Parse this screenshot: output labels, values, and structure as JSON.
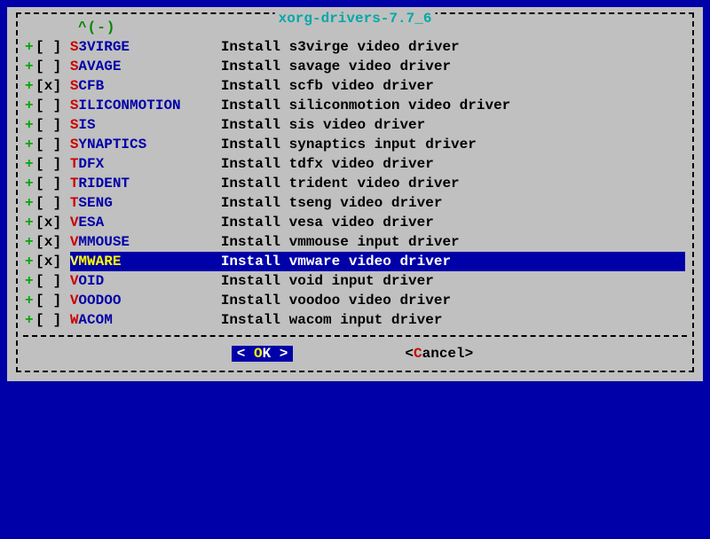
{
  "title": "xorg-drivers-7.7_6",
  "scroll_hint": "^(-)",
  "items": [
    {
      "checked": false,
      "hot": "S",
      "rest": "3VIRGE",
      "desc": "Install s3virge video driver",
      "selected": false
    },
    {
      "checked": false,
      "hot": "S",
      "rest": "AVAGE",
      "desc": "Install savage video driver",
      "selected": false
    },
    {
      "checked": true,
      "hot": "S",
      "rest": "CFB",
      "desc": "Install scfb video driver",
      "selected": false
    },
    {
      "checked": false,
      "hot": "S",
      "rest": "ILICONMOTION",
      "desc": "Install siliconmotion video driver",
      "selected": false
    },
    {
      "checked": false,
      "hot": "S",
      "rest": "IS",
      "desc": "Install sis video driver",
      "selected": false
    },
    {
      "checked": false,
      "hot": "S",
      "rest": "YNAPTICS",
      "desc": "Install synaptics input driver",
      "selected": false
    },
    {
      "checked": false,
      "hot": "T",
      "rest": "DFX",
      "desc": "Install tdfx video driver",
      "selected": false
    },
    {
      "checked": false,
      "hot": "T",
      "rest": "RIDENT",
      "desc": "Install trident video driver",
      "selected": false
    },
    {
      "checked": false,
      "hot": "T",
      "rest": "SENG",
      "desc": "Install tseng video driver",
      "selected": false
    },
    {
      "checked": true,
      "hot": "V",
      "rest": "ESA",
      "desc": "Install vesa video driver",
      "selected": false
    },
    {
      "checked": true,
      "hot": "V",
      "rest": "MMOUSE",
      "desc": "Install vmmouse input driver",
      "selected": false
    },
    {
      "checked": true,
      "hot": "V",
      "rest": "MWARE",
      "desc": "Install vmware video driver",
      "selected": true
    },
    {
      "checked": false,
      "hot": "V",
      "rest": "OID",
      "desc": "Install void input driver",
      "selected": false
    },
    {
      "checked": false,
      "hot": "V",
      "rest": "OODOO",
      "desc": "Install voodoo video driver",
      "selected": false
    },
    {
      "checked": false,
      "hot": "W",
      "rest": "ACOM",
      "desc": "Install wacom input driver",
      "selected": false
    }
  ],
  "buttons": {
    "ok": {
      "left": "<",
      "hot": " O",
      "rest": "K ",
      "right": ">"
    },
    "cancel": {
      "left": "<",
      "hot": "C",
      "rest": "ancel",
      "right": ">"
    }
  }
}
